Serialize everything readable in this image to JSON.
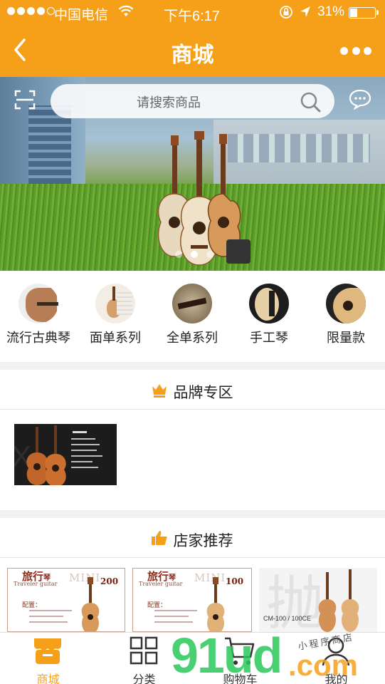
{
  "status_bar": {
    "carrier": "中国电信",
    "time": "下午6:17",
    "battery": "31%",
    "battery_level": 0.31,
    "signal_bars": 4
  },
  "header": {
    "title": "商城",
    "back_icon": "chevron-left-icon",
    "more_icon": "more-dots-icon"
  },
  "banner": {
    "search_placeholder": "请搜索商品",
    "slide_count": 3,
    "active_slide": 0
  },
  "categories": [
    {
      "label": "流行古典琴",
      "icon": "classical-guitar-body"
    },
    {
      "label": "面单系列",
      "icon": "acoustic-guitar"
    },
    {
      "label": "全单系列",
      "icon": "guitar-bridge"
    },
    {
      "label": "手工琴",
      "icon": "guitar-soundhole"
    },
    {
      "label": "限量款",
      "icon": "guitar-cutaway"
    }
  ],
  "brand_section": {
    "title": "品牌专区",
    "icon": "crown-icon"
  },
  "recommend_section": {
    "title": "店家推荐",
    "icon": "thumbs-up-icon",
    "cards": [
      {
        "title_zh": "旅行",
        "title_small": "琴",
        "title_en": "Traveler guitar",
        "series": "MINI",
        "model": "200",
        "config_label": "配置："
      },
      {
        "title_zh": "旅行",
        "title_small": "琴",
        "title_en": "Traveler guitar",
        "series": "MINI",
        "model": "100",
        "config_label": "配置："
      },
      {
        "model_text": "CM-100 / 100CE"
      }
    ]
  },
  "tabbar": [
    {
      "label": "商城",
      "icon": "store-icon",
      "active": true
    },
    {
      "label": "分类",
      "icon": "grid-icon",
      "active": false
    },
    {
      "label": "购物车",
      "icon": "cart-icon",
      "active": false
    },
    {
      "label": "我的",
      "icon": "user-icon",
      "active": false
    }
  ],
  "watermark": {
    "main": "91ud",
    "suffix": ".com",
    "handwritten": "小程序商店"
  },
  "colors": {
    "brand": "#f6a019",
    "background": "#f2f2f2",
    "text": "#222222"
  }
}
